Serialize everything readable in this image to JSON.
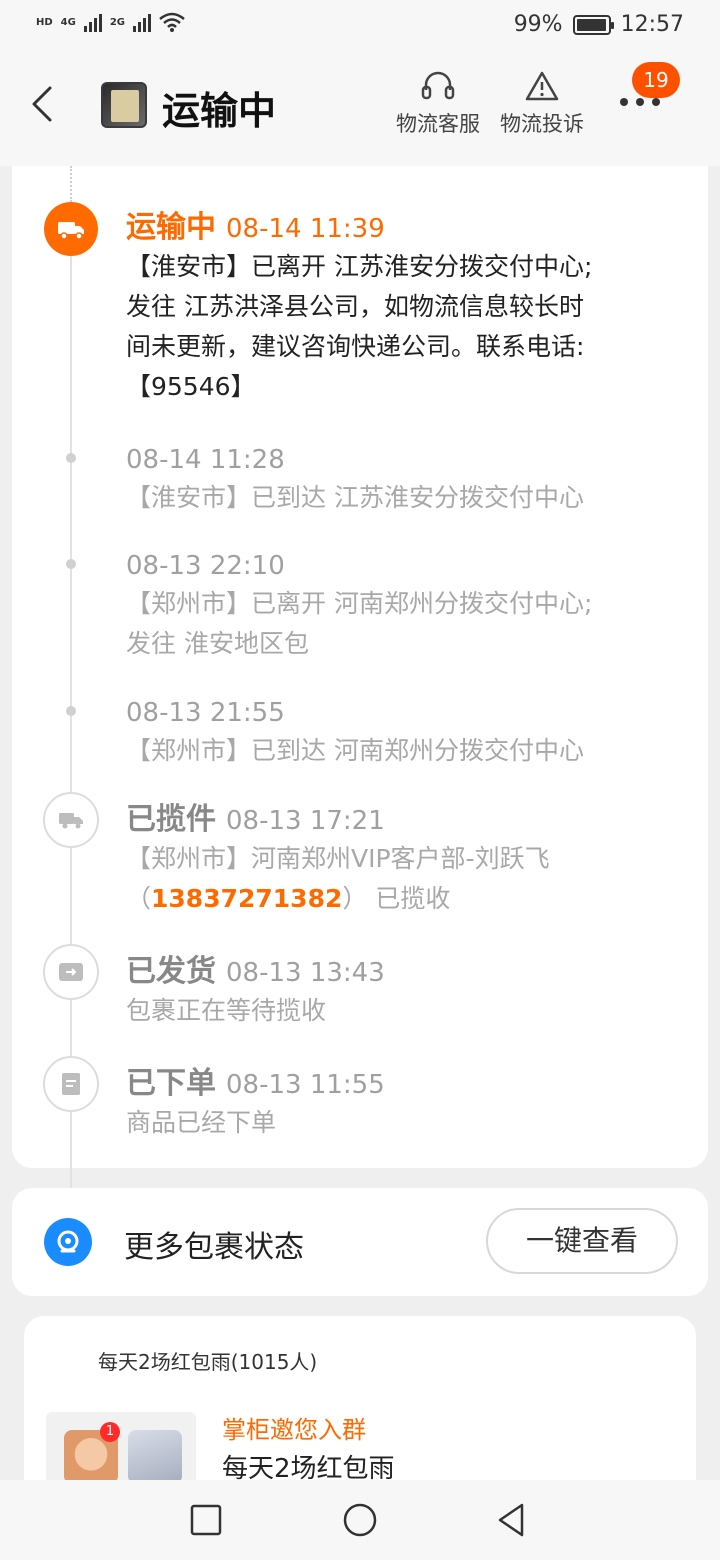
{
  "status_bar": {
    "left": [
      "HD",
      "4G",
      "2G"
    ],
    "battery": "99%",
    "battery_level": 0.99,
    "time": "12:57"
  },
  "header": {
    "title": "运输中",
    "actions": [
      {
        "label": "物流客服",
        "icon": "headset-icon"
      },
      {
        "label": "物流投诉",
        "icon": "warning-icon"
      }
    ],
    "badge": "19"
  },
  "timeline": [
    {
      "status": "运输中",
      "time": "08-14 11:39",
      "lines": [
        "【淮安市】已离开 江苏淮安分拨交付中心;",
        "发往 江苏洪泽县公司，如物流信息较长时",
        "间未更新，建议咨询快递公司。联系电话:",
        "【95546】"
      ]
    },
    {
      "status": "",
      "time": "08-14 11:28",
      "lines": [
        "【淮安市】已到达 江苏淮安分拨交付中心"
      ]
    },
    {
      "status": "",
      "time": "08-13 22:10",
      "lines": [
        "【郑州市】已离开 河南郑州分拨交付中心;",
        "发往 淮安地区包"
      ]
    },
    {
      "status": "",
      "time": "08-13 21:55",
      "lines": [
        "【郑州市】已到达 河南郑州分拨交付中心"
      ]
    },
    {
      "status": "已揽件",
      "time": "08-13 17:21",
      "lines": [
        "【郑州市】河南郑州VIP客户部-刘跃飞"
      ],
      "phone_prefix": "（",
      "phone": "13837271382",
      "phone_suffix": "） 已揽收"
    },
    {
      "status": "已发货",
      "time": "08-13 13:43",
      "lines": [
        "包裹正在等待揽收"
      ]
    },
    {
      "status": "已下单",
      "time": "08-13 11:55",
      "lines": [
        "商品已经下单"
      ]
    }
  ],
  "more_packages": {
    "label": "更多包裹状态",
    "button": "一键查看"
  },
  "group": {
    "title": "每天2场红包雨(1015人)",
    "invite": "掌柜邀您入群",
    "subtitle": "每天2场红包雨",
    "unread": "1"
  }
}
